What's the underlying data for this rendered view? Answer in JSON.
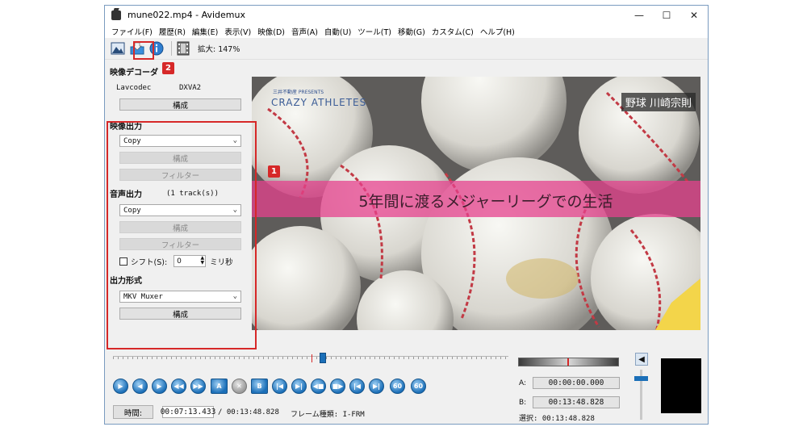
{
  "window": {
    "title": "mune022.mp4 - Avidemux",
    "minimize": "—",
    "maximize": "☐",
    "close": "✕"
  },
  "menu": [
    "ファイル(F)",
    "履歴(R)",
    "編集(E)",
    "表示(V)",
    "映像(D)",
    "音声(A)",
    "自動(U)",
    "ツール(T)",
    "移動(G)",
    "カスタム(C)",
    "ヘルプ(H)"
  ],
  "toolbar": {
    "zoom_label": "拡大: 147%"
  },
  "video_decoder": {
    "title": "映像デコーダ",
    "codec_name": "Lavcodec",
    "codec_value": "DXVA2",
    "configure": "構成"
  },
  "video_output": {
    "title": "映像出力",
    "codec": "Copy",
    "configure": "構成",
    "filters": "フィルター"
  },
  "audio_output": {
    "title": "音声出力",
    "tracks": "(1 track(s))",
    "codec": "Copy",
    "configure": "構成",
    "filters": "フィルター",
    "shift_label": "シフト(S):",
    "shift_value": "0",
    "shift_unit": "ミリ秒"
  },
  "output_format": {
    "title": "出力形式",
    "muxer": "MKV Muxer",
    "configure": "構成"
  },
  "video_overlay": {
    "sponsor": "三井不動産 PRESENTS",
    "program": "CRAZY ATHLETES",
    "name": "野球 川崎宗則",
    "caption": "5年間に渡るメジャーリーグでの生活"
  },
  "annotations": {
    "badge1": "1",
    "badge2": "2"
  },
  "status": {
    "time_button": "時間:",
    "current_time": "00:07:13.433",
    "total_time": "/ 00:13:48.828",
    "frame_type": "フレーム種類: I-FRM",
    "a_label": "A:",
    "a_value": "00:00:00.000",
    "b_label": "B:",
    "b_value": "00:13:48.828",
    "selection": "選択:  00:13:48.828"
  },
  "playhead_fraction": 0.523,
  "colors": {
    "accent_red": "#d62828",
    "caption_pink": "#e5418e",
    "button_blue": "#1b6fb8"
  }
}
